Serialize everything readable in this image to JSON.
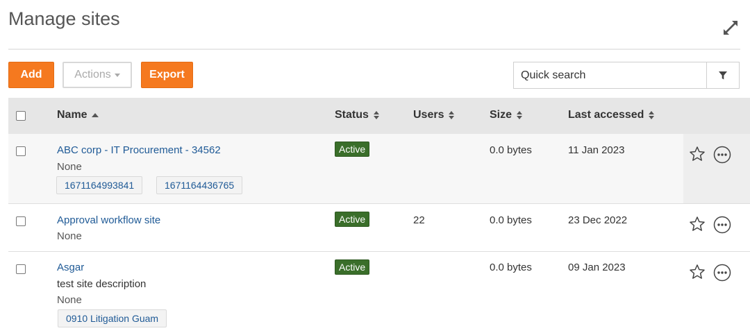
{
  "page": {
    "title": "Manage sites"
  },
  "toolbar": {
    "add_label": "Add",
    "actions_label": "Actions",
    "export_label": "Export",
    "search_placeholder": "Quick search"
  },
  "table": {
    "columns": {
      "name": "Name",
      "status": "Status",
      "users": "Users",
      "size": "Size",
      "last_accessed": "Last accessed"
    },
    "rows": [
      {
        "name": "ABC corp - IT Procurement - 34562",
        "description": "",
        "category": "None",
        "tags": [
          "1671164993841",
          "1671164436765"
        ],
        "status": "Active",
        "users": "",
        "size": "0.0 bytes",
        "last_accessed": "11 Jan 2023"
      },
      {
        "name": "Approval workflow site",
        "description": "",
        "category": "None",
        "tags": [],
        "status": "Active",
        "users": "22",
        "size": "0.0 bytes",
        "last_accessed": "23 Dec 2022"
      },
      {
        "name": "Asgar",
        "description": "test site description",
        "category": "None",
        "tags": [
          "0910 Litigation Guam"
        ],
        "status": "Active",
        "users": "",
        "size": "0.0 bytes",
        "last_accessed": "09 Jan 2023"
      }
    ]
  },
  "icons": {
    "expand": "expand-icon",
    "filter": "filter-icon",
    "sort": "sort-icon",
    "star": "star-icon",
    "more": "more-options-icon"
  },
  "colors": {
    "accent": "#f5791f",
    "link": "#1f5a96",
    "status_active": "#3a6e2a",
    "header_bg": "#e6e6e6"
  }
}
